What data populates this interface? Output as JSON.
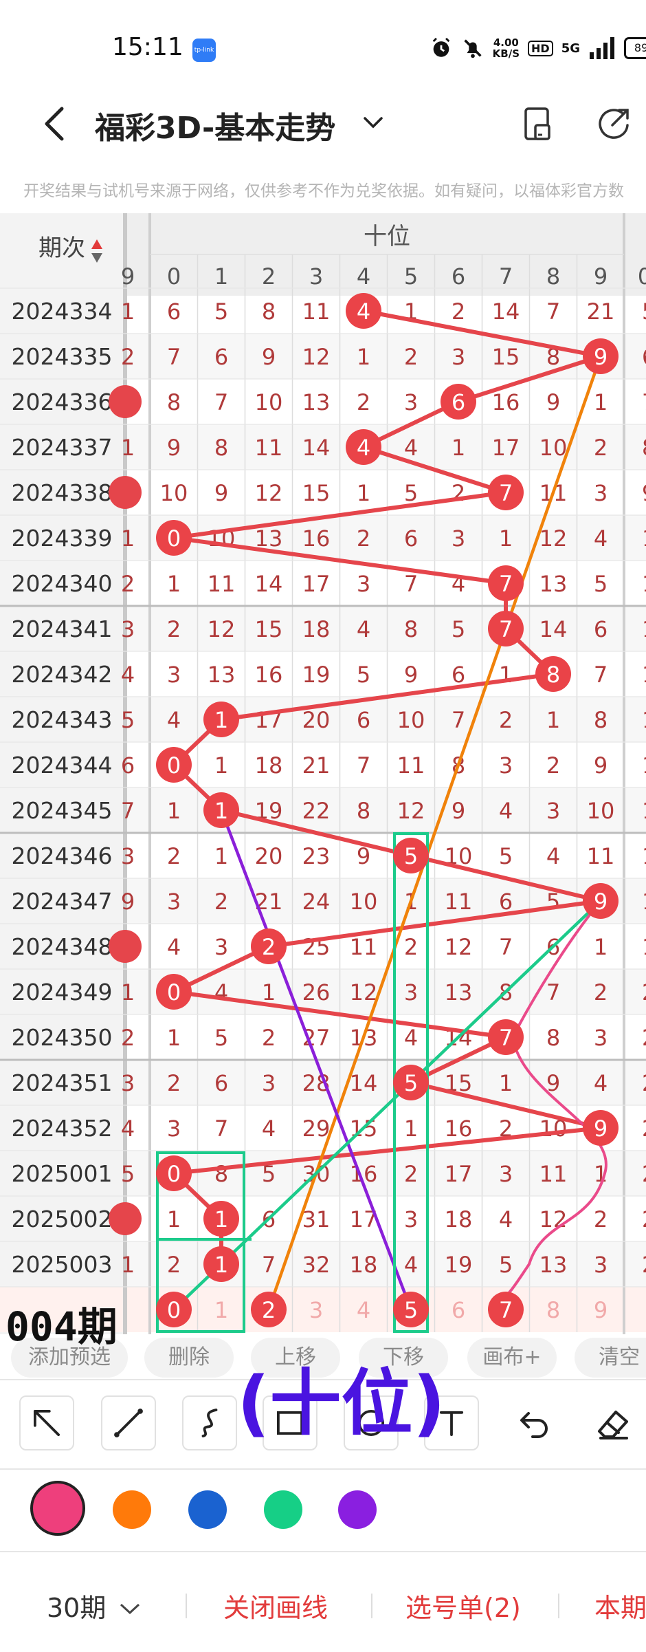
{
  "status_bar": {
    "time": "15:11",
    "app_icon": "tp-link",
    "net_speed_value": "4.00",
    "net_speed_unit": "KB/S",
    "hd_badge": "HD",
    "network": "5G",
    "battery": "89"
  },
  "header": {
    "title": "福彩3D-基本走势",
    "disclaimer": "开奖结果与试机号来源于网络，仅供参考不作为兑奖依据。如有疑问，以福体彩官方数"
  },
  "chart_data": {
    "type": "table",
    "group_label": "十位",
    "period_header": "期次",
    "columns": [
      "0",
      "1",
      "2",
      "3",
      "4",
      "5",
      "6",
      "7",
      "8",
      "9"
    ],
    "left_partial": [
      "1",
      "2",
      "9",
      "1",
      "9",
      "1",
      "2",
      "3",
      "4",
      "5",
      "6",
      "7",
      "3",
      "9",
      "9",
      "1",
      "2",
      "3",
      "4",
      "5",
      "9",
      "1"
    ],
    "right_partial": [
      "5",
      "6",
      "7",
      "8",
      "9",
      "10",
      "1",
      "1",
      "1",
      "1",
      "1",
      "1",
      "1",
      "1",
      "1",
      "2",
      "2",
      "2",
      "2",
      "2",
      "2",
      "2"
    ],
    "rows": [
      {
        "period": "2024334",
        "values": [
          6,
          5,
          8,
          11,
          4,
          1,
          2,
          14,
          7,
          21
        ],
        "hit": 4
      },
      {
        "period": "2024335",
        "values": [
          7,
          6,
          9,
          12,
          1,
          2,
          3,
          15,
          8,
          9
        ],
        "hit": 9
      },
      {
        "period": "2024336",
        "values": [
          8,
          7,
          10,
          13,
          2,
          3,
          6,
          16,
          9,
          1
        ],
        "hit": 6
      },
      {
        "period": "2024337",
        "values": [
          9,
          8,
          11,
          14,
          4,
          4,
          1,
          17,
          10,
          2
        ],
        "hit": 4
      },
      {
        "period": "2024338",
        "values": [
          10,
          9,
          12,
          15,
          1,
          5,
          2,
          7,
          11,
          3
        ],
        "hit": 7
      },
      {
        "period": "2024339",
        "values": [
          0,
          10,
          13,
          16,
          2,
          6,
          3,
          1,
          12,
          4
        ],
        "hit": 0
      },
      {
        "period": "2024340",
        "values": [
          1,
          11,
          14,
          17,
          3,
          7,
          4,
          7,
          13,
          5
        ],
        "hit": 7
      },
      {
        "period": "2024341",
        "values": [
          2,
          12,
          15,
          18,
          4,
          8,
          5,
          7,
          14,
          6
        ],
        "hit": 7
      },
      {
        "period": "2024342",
        "values": [
          3,
          13,
          16,
          19,
          5,
          9,
          6,
          1,
          8,
          7
        ],
        "hit": 8
      },
      {
        "period": "2024343",
        "values": [
          4,
          1,
          17,
          20,
          6,
          10,
          7,
          2,
          1,
          8
        ],
        "hit": 1
      },
      {
        "period": "2024344",
        "values": [
          0,
          1,
          18,
          21,
          7,
          11,
          8,
          3,
          2,
          9
        ],
        "hit": 0
      },
      {
        "period": "2024345",
        "values": [
          1,
          1,
          19,
          22,
          8,
          12,
          9,
          4,
          3,
          10
        ],
        "hit": 1
      },
      {
        "period": "2024346",
        "values": [
          2,
          1,
          20,
          23,
          9,
          5,
          10,
          5,
          4,
          11
        ],
        "hit": 5
      },
      {
        "period": "2024347",
        "values": [
          3,
          2,
          21,
          24,
          10,
          1,
          11,
          6,
          5,
          9
        ],
        "hit": 9
      },
      {
        "period": "2024348",
        "values": [
          4,
          3,
          2,
          25,
          11,
          2,
          12,
          7,
          6,
          1
        ],
        "hit": 2
      },
      {
        "period": "2024349",
        "values": [
          0,
          4,
          1,
          26,
          12,
          3,
          13,
          8,
          7,
          2
        ],
        "hit": 0
      },
      {
        "period": "2024350",
        "values": [
          1,
          5,
          2,
          27,
          13,
          4,
          14,
          7,
          8,
          3
        ],
        "hit": 7
      },
      {
        "period": "2024351",
        "values": [
          2,
          6,
          3,
          28,
          14,
          5,
          15,
          1,
          9,
          4
        ],
        "hit": 5
      },
      {
        "period": "2024352",
        "values": [
          3,
          7,
          4,
          29,
          15,
          1,
          16,
          2,
          10,
          9
        ],
        "hit": 9
      },
      {
        "period": "2025001",
        "values": [
          0,
          8,
          5,
          30,
          16,
          2,
          17,
          3,
          11,
          1
        ],
        "hit": 0
      },
      {
        "period": "2025002",
        "values": [
          1,
          1,
          6,
          31,
          17,
          3,
          18,
          4,
          12,
          2
        ],
        "hit": 1
      },
      {
        "period": "2025003",
        "values": [
          2,
          1,
          7,
          32,
          18,
          4,
          19,
          5,
          13,
          3
        ],
        "hit": 1
      }
    ],
    "prediction_row": {
      "values": [
        0,
        1,
        2,
        3,
        4,
        5,
        6,
        7,
        8,
        9
      ],
      "selected": [
        0,
        2,
        5,
        7
      ]
    },
    "line_colors": {
      "trend": "#e5454b",
      "orange": "#f0820a",
      "purple": "#8a1fd9",
      "green": "#1ccb8b",
      "pink": "#ea4a8a"
    }
  },
  "tool_row": {
    "items": [
      "添加预选",
      "删除",
      "上移",
      "下移",
      "画布+",
      "清空"
    ]
  },
  "draw_toolbar": {
    "tools": [
      "arrow-icon",
      "line-icon",
      "curve-icon",
      "rectangle-icon",
      "circle-icon",
      "text-icon",
      "undo-icon",
      "eraser-icon"
    ]
  },
  "color_swatches": [
    "#ee3f7c",
    "#ff7a0a",
    "#1a62d0",
    "#16cf86",
    "#8a1fe0"
  ],
  "bottom_bar": {
    "periods": "30期",
    "close_lines": "关闭画线",
    "selection": "选号单(2)",
    "current": "本期"
  },
  "overlay": {
    "periods_note": "004期",
    "label": "(十位)"
  }
}
